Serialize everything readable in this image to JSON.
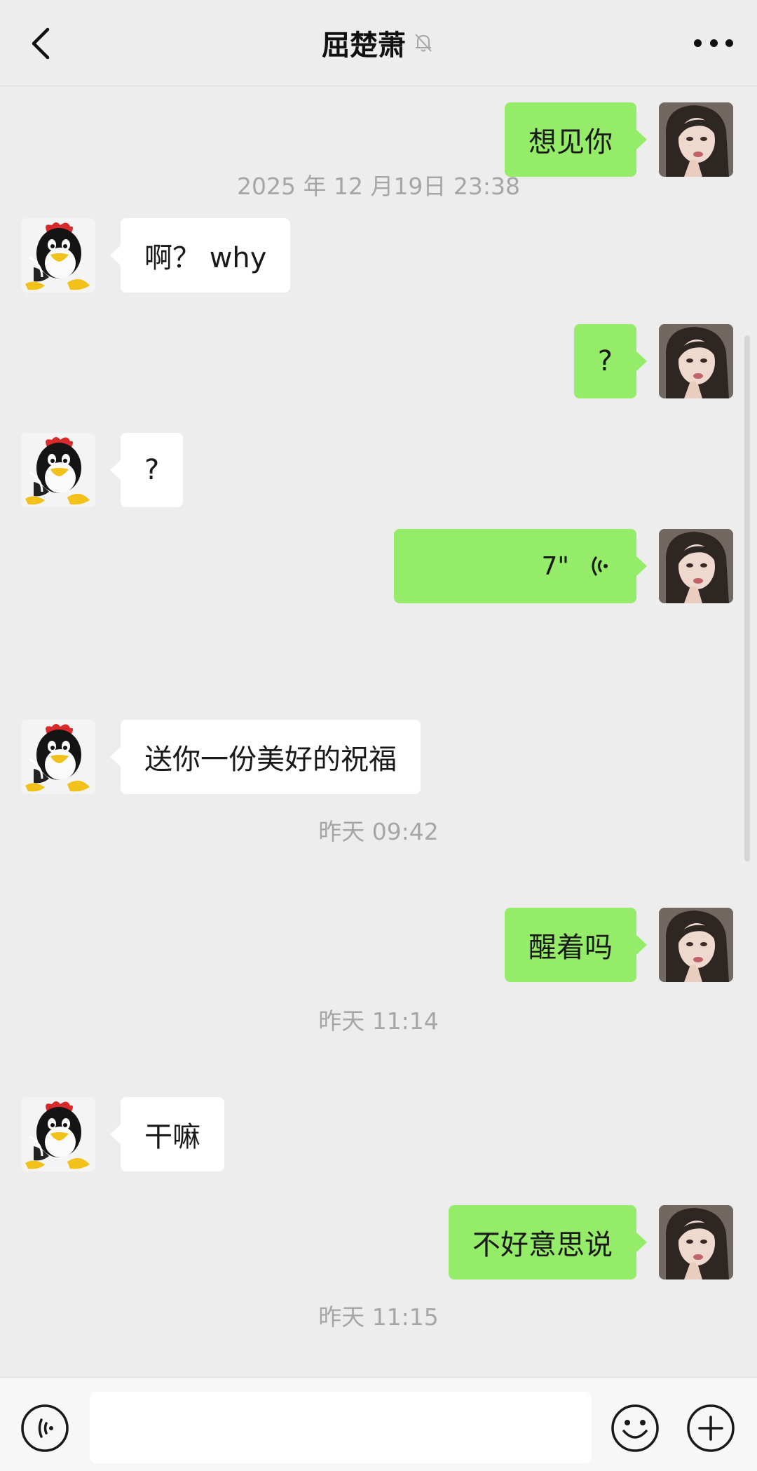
{
  "header": {
    "title": "屈楚萧",
    "back_icon": "chevron-left-icon",
    "mute_icon": "bell-off-icon",
    "more_icon": "more-horizontal-icon"
  },
  "messages": [
    {
      "type": "text",
      "from": "me",
      "text": "想见你"
    },
    {
      "type": "timestamp",
      "text": "2025 年 12 月19日 23:38"
    },
    {
      "type": "text",
      "from": "peer",
      "text": "啊？ why"
    },
    {
      "type": "text",
      "from": "me",
      "text": "?"
    },
    {
      "type": "text",
      "from": "peer",
      "text": "?"
    },
    {
      "type": "voice",
      "from": "me",
      "duration": "7\"",
      "icon": "voice-wave-icon"
    },
    {
      "type": "text",
      "from": "peer",
      "text": "送你一份美好的祝福"
    },
    {
      "type": "timestamp",
      "text": "昨天 09:42"
    },
    {
      "type": "text",
      "from": "me",
      "text": "醒着吗"
    },
    {
      "type": "timestamp",
      "text": "昨天 11:14"
    },
    {
      "type": "text",
      "from": "peer",
      "text": "干嘛"
    },
    {
      "type": "text",
      "from": "me",
      "text": "不好意思说"
    },
    {
      "type": "timestamp",
      "text": "昨天 11:15"
    }
  ],
  "input_bar": {
    "voice_icon": "voice-input-icon",
    "text_value": "",
    "emoji_icon": "emoji-icon",
    "plus_icon": "plus-circle-icon"
  },
  "colors": {
    "background": "#ededed",
    "my_bubble": "#95ec69",
    "peer_bubble": "#ffffff",
    "timestamp_text": "#a6a6a6"
  }
}
